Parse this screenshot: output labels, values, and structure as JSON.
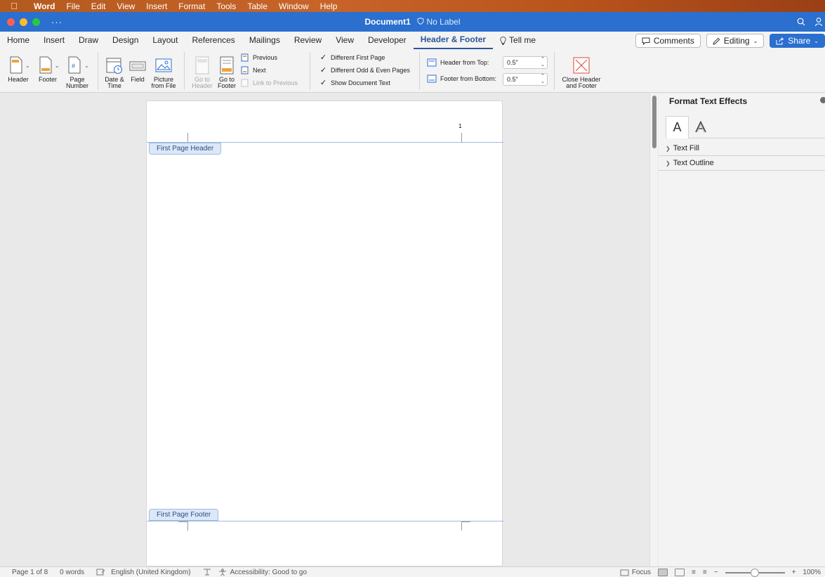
{
  "menubar": {
    "app": "Word",
    "items": [
      "File",
      "Edit",
      "View",
      "Insert",
      "Format",
      "Tools",
      "Table",
      "Window",
      "Help"
    ]
  },
  "titlebar": {
    "document": "Document1",
    "label": "No Label"
  },
  "tabs": [
    "Home",
    "Insert",
    "Draw",
    "Design",
    "Layout",
    "References",
    "Mailings",
    "Review",
    "View",
    "Developer",
    "Header & Footer"
  ],
  "tell_me": "Tell me",
  "toolbar_right": {
    "comments": "Comments",
    "editing": "Editing",
    "share": "Share"
  },
  "ribbon": {
    "header": "Header",
    "footer": "Footer",
    "page_number_1": "Page",
    "page_number_2": "Number",
    "date_time_1": "Date &",
    "date_time_2": "Time",
    "field": "Field",
    "picture_1": "Picture",
    "picture_2": "from File",
    "goto_header_1": "Go to",
    "goto_header_2": "Header",
    "goto_footer_1": "Go to",
    "goto_footer_2": "Footer",
    "previous": "Previous",
    "next": "Next",
    "link_to_previous": "Link to Previous",
    "different_first_page": "Different First Page",
    "different_odd_even": "Different Odd & Even Pages",
    "show_document_text": "Show Document Text",
    "header_from_top_label": "Header from Top:",
    "header_from_top_value": "0.5\"",
    "footer_from_bottom_label": "Footer from Bottom:",
    "footer_from_bottom_value": "0.5\"",
    "close_1": "Close Header",
    "close_2": "and Footer"
  },
  "page": {
    "page_number": "1",
    "header_tag": "First Page Header",
    "footer_tag": "First Page Footer"
  },
  "pane": {
    "title": "Format Text Effects",
    "tab_a": "A",
    "tab_a_outline": "A",
    "sections": [
      "Text Fill",
      "Text Outline"
    ]
  },
  "status": {
    "page": "Page 1 of 8",
    "words": "0 words",
    "language": "English (United Kingdom)",
    "accessibility": "Accessibility: Good to go",
    "focus": "Focus",
    "zoom": "100%",
    "zoom_minus": "−",
    "zoom_plus": "+"
  },
  "colors": {
    "titlebar": "#2b6fcf",
    "active_tab": "#2b5797",
    "hf_line": "#9dbbe3"
  }
}
